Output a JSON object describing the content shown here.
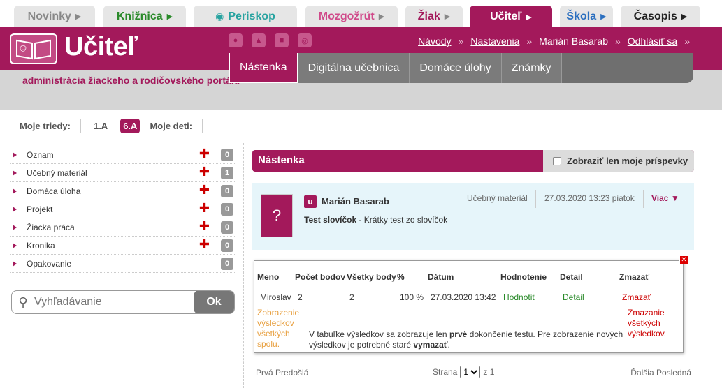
{
  "portal_tabs": [
    {
      "label": "Novinky",
      "color": "#888888"
    },
    {
      "label": "Knižnica",
      "color": "#2a8a2a"
    },
    {
      "label": "Periskop",
      "color": "#27a3a0"
    },
    {
      "label": "Mozgožrút",
      "color": "#d04a8a"
    },
    {
      "label": "Žiak",
      "color": "#a3195b"
    },
    {
      "label": "Učiteľ",
      "color": "#ffffff"
    },
    {
      "label": "Škola",
      "color": "#2b6fbf"
    },
    {
      "label": "Časopis",
      "color": "#222222"
    }
  ],
  "header": {
    "title": "Učiteľ",
    "subtitle": "administrácia žiackeho a rodičovského portálu",
    "links": {
      "guides": "Návody",
      "settings": "Nastavenia",
      "user": "Marián Basarab",
      "logout": "Odhlásiť sa"
    },
    "nav": [
      "Nástenka",
      "Digitálna učebnica",
      "Domáce úlohy",
      "Známky"
    ]
  },
  "classes": {
    "my_classes_label": "Moje triedy:",
    "items": [
      "1.A",
      "6.A"
    ],
    "my_children_label": "Moje deti:"
  },
  "sidebar": {
    "items": [
      {
        "label": "Oznam",
        "count": "0"
      },
      {
        "label": "Učebný materiál",
        "count": "1"
      },
      {
        "label": "Domáca úloha",
        "count": "0"
      },
      {
        "label": "Projekt",
        "count": "0"
      },
      {
        "label": "Žiacka práca",
        "count": "0"
      },
      {
        "label": "Kronika",
        "count": "0"
      },
      {
        "label": "Opakovanie",
        "count": "0"
      }
    ],
    "search_placeholder": "Vyhľadávanie",
    "search_button": "Ok"
  },
  "board": {
    "title": "Nástenka",
    "filter_label": "Zobraziť len moje príspevky",
    "post": {
      "badge": "u",
      "author": "Marián Basarab",
      "category": "Učebný materiál",
      "date": "27.03.2020 13:23 piatok",
      "more": "Viac",
      "title": "Test slovíčok",
      "description": " - Krátky test zo slovíčok"
    }
  },
  "results": {
    "headers": [
      "Meno",
      "Počet bodov",
      "Všetky body",
      "%",
      "Dátum",
      "Hodnotenie",
      "Detail",
      "Zmazať"
    ],
    "row": [
      "Miroslav",
      "2",
      "2",
      "100 %",
      "27.03.2020 13:42",
      "Hodnotiť",
      "Detail",
      "Zmazať"
    ],
    "show_all_text": "Zobrazenie výsledkov všetkých spolu.",
    "delete_results_text": "Zmazanie všetkých výsledkov.",
    "note_start": "V tabuľke výsledkov sa zobrazuje len ",
    "note_bold1": "prvé",
    "note_mid": " dokončenie testu. Pre zobrazenie nových výsledkov je potrebné staré ",
    "note_bold2": "vymazať",
    "note_end": "."
  },
  "pager": {
    "first_prev": "Prvá Predošlá",
    "page_label": "Strana",
    "page_value": "1",
    "of_label": "z 1",
    "next_last": "Ďalšia Posledná"
  }
}
